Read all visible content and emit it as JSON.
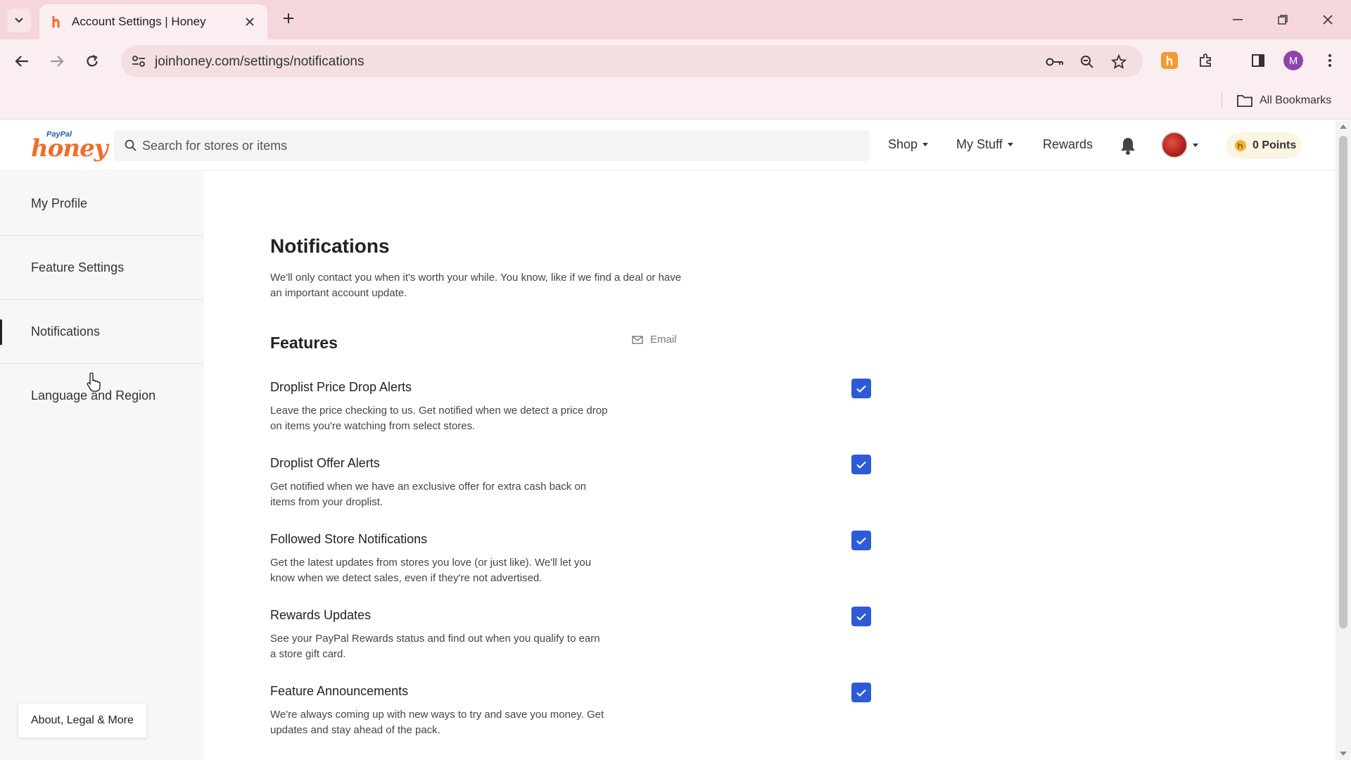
{
  "browser": {
    "tab_title": "Account Settings | Honey",
    "url": "joinhoney.com/settings/notifications",
    "bookmarks_label": "All Bookmarks",
    "profile_initial": "M"
  },
  "header": {
    "logo_paypal": "PayPal",
    "logo_honey": "honey",
    "search_placeholder": "Search for stores or items",
    "nav": {
      "shop": "Shop",
      "my_stuff": "My Stuff",
      "rewards": "Rewards"
    },
    "points": "0 Points"
  },
  "sidebar": {
    "items": [
      {
        "label": "My Profile"
      },
      {
        "label": "Feature Settings"
      },
      {
        "label": "Notifications",
        "active": true
      },
      {
        "label": "Language and Region"
      }
    ],
    "about": "About, Legal & More"
  },
  "main": {
    "title": "Notifications",
    "description": "We'll only contact you when it's worth your while. You know, like if we find a deal or have an important account update.",
    "section_title": "Features",
    "column_header": "Email",
    "features": [
      {
        "name": "Droplist Price Drop Alerts",
        "description": "Leave the price checking to us. Get notified when we detect a price drop on items you're watching from select stores.",
        "email": true
      },
      {
        "name": "Droplist Offer Alerts",
        "description": "Get notified when we have an exclusive offer for extra cash back on items from your droplist.",
        "email": true
      },
      {
        "name": "Followed Store Notifications",
        "description": "Get the latest updates from stores you love (or just like). We'll let you know when we detect sales, even if they're not advertised.",
        "email": true
      },
      {
        "name": "Rewards Updates",
        "description": "See your PayPal Rewards status and find out when you qualify to earn a store gift card.",
        "email": true
      },
      {
        "name": "Feature Announcements",
        "description": "We're always coming up with new ways to try and save you money. Get updates and stay ahead of the pack.",
        "email": true
      }
    ]
  },
  "colors": {
    "checkbox": "#2d5bd7",
    "tabbar": "#f5d6db",
    "honey_orange": "#f26c2b",
    "paypal_blue": "#1f5fae"
  }
}
